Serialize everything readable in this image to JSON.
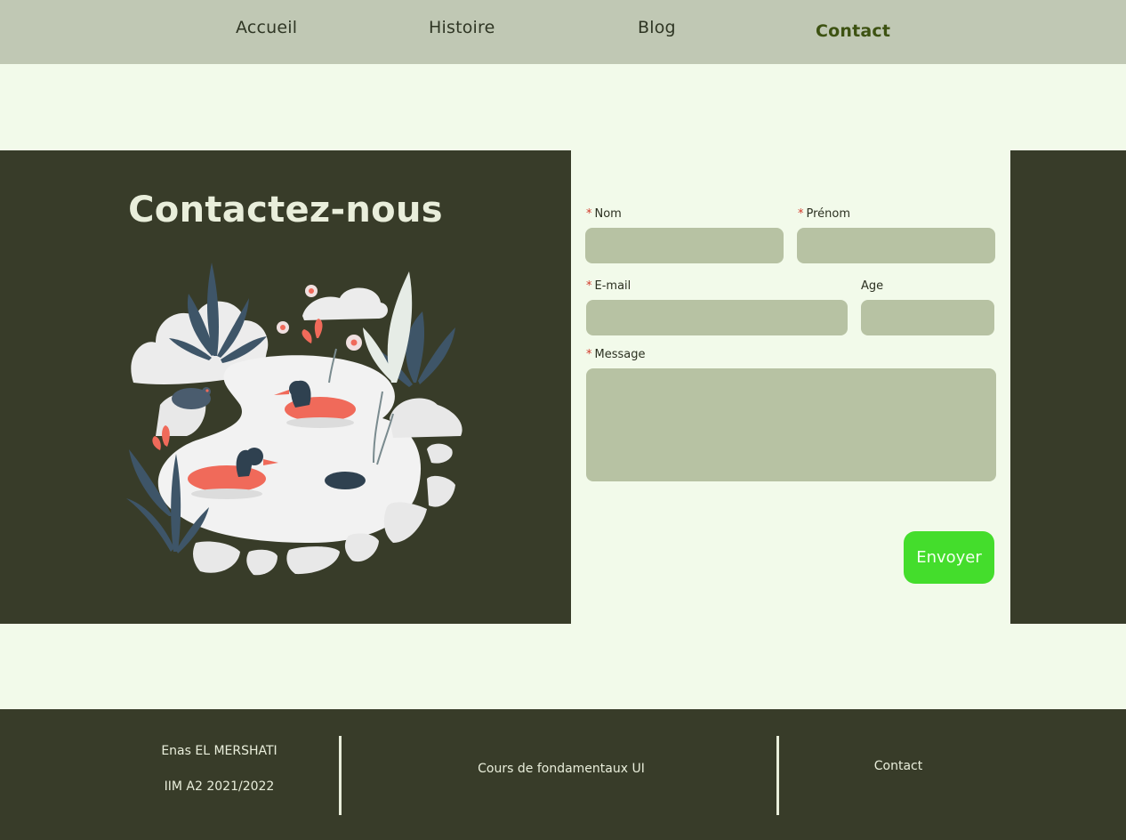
{
  "nav": {
    "items": [
      {
        "label": "Accueil"
      },
      {
        "label": "Histoire"
      },
      {
        "label": "Blog"
      },
      {
        "label": "Contact"
      }
    ],
    "active": "Contact"
  },
  "hero": {
    "title": "Contactez-nous",
    "illustration": "pond-ducks-illustration"
  },
  "form": {
    "required_mark": "*",
    "nom_label": "Nom",
    "prenom_label": "Prénom",
    "email_label": "E-mail",
    "age_label": "Age",
    "message_label": "Message",
    "nom_value": "",
    "prenom_value": "",
    "email_value": "",
    "age_value": "",
    "message_value": "",
    "submit_label": "Envoyer"
  },
  "footer": {
    "author": "Enas EL MERSHATI",
    "class_info": "IIM A2 2021/2022",
    "course": "Cours de fondamentaux UI",
    "contact": "Contact"
  },
  "colors": {
    "nav_bg": "#c0c8b4",
    "page_bg": "#f2faea",
    "dark": "#383c29",
    "field": "#b7c2a3",
    "button": "#44dd2c",
    "active_link": "#3d5212"
  }
}
